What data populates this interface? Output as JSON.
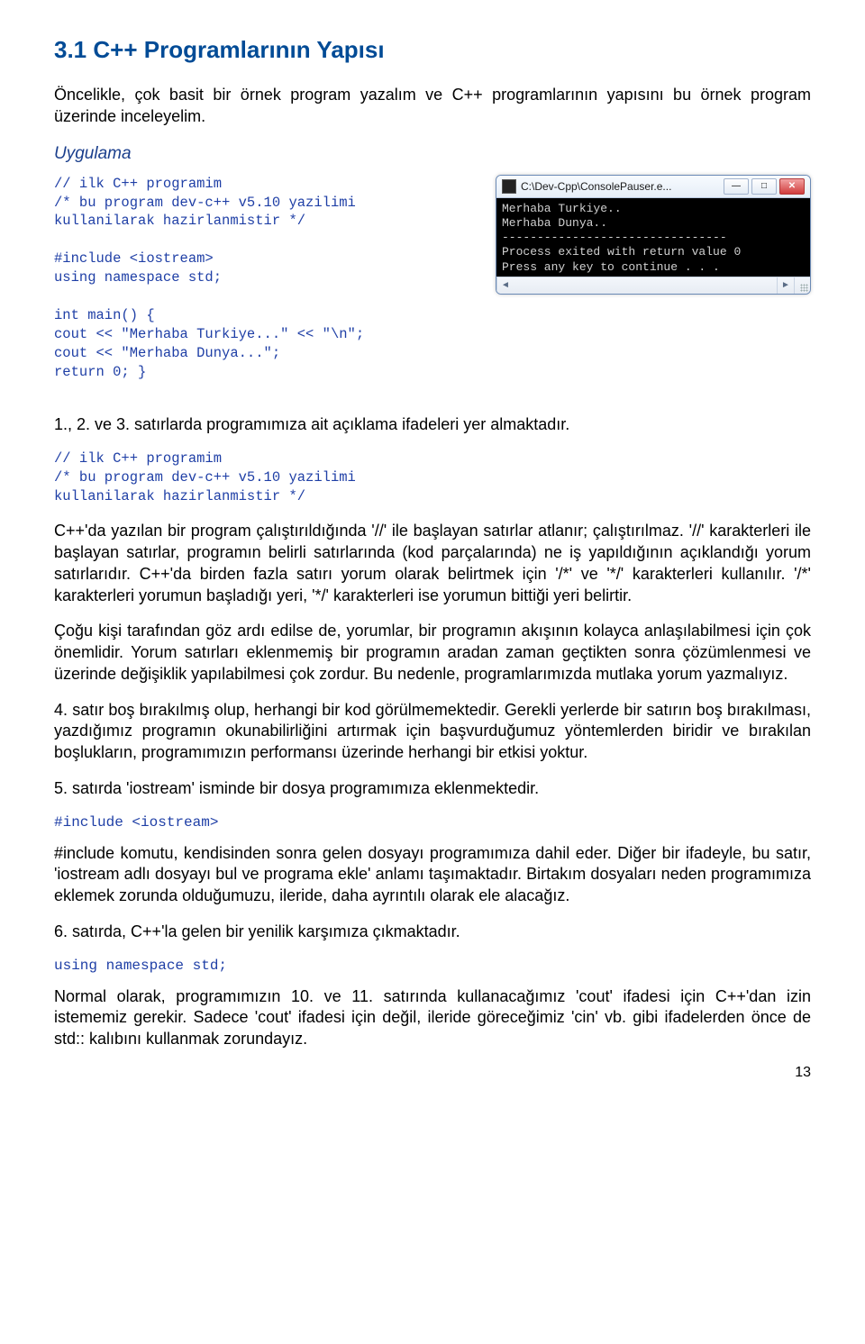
{
  "section_title": "3.1 C++ Programlarının Yapısı",
  "intro": "Öncelikle, çok basit bir örnek program yazalım ve C++ programlarının yapısını bu örnek program üzerinde inceleyelim.",
  "app_label": "Uygulama",
  "code1": "// ilk C++ programim\n/* bu program dev-c++ v5.10 yazilimi\nkullanilarak hazirlanmistir */\n\n#include <iostream>\nusing namespace std;\n\nint main() {\ncout << \"Merhaba Turkiye...\" << \"\\n\";\ncout << \"Merhaba Dunya...\";\nreturn 0; }",
  "console": {
    "title": "C:\\Dev-Cpp\\ConsolePauser.e...",
    "body": "Merhaba Turkiye..\nMerhaba Dunya..\n--------------------------------\nProcess exited with return value 0\nPress any key to continue . . .",
    "btn_min": "—",
    "btn_max": "□",
    "btn_close": "✕"
  },
  "p1": "1., 2. ve 3. satırlarda programımıza ait açıklama ifadeleri yer almaktadır.",
  "code2": "// ilk C++ programim\n/* bu program dev-c++ v5.10 yazilimi\nkullanilarak hazirlanmistir */",
  "p2": "C++'da yazılan bir program çalıştırıldığında '//' ile başlayan satırlar atlanır; çalıştırılmaz. '//' karakterleri ile başlayan satırlar, programın belirli satırlarında (kod parçalarında) ne iş yapıldığının açıklandığı yorum satırlarıdır. C++'da birden fazla satırı yorum olarak belirtmek için '/*' ve '*/' karakterleri kullanılır. '/*' karakterleri yorumun başladığı yeri, '*/' karakterleri ise yorumun bittiği yeri belirtir.",
  "p3": "Çoğu kişi tarafından göz ardı edilse de, yorumlar, bir programın akışının kolayca anlaşılabilmesi için çok önemlidir. Yorum satırları eklenmemiş bir programın aradan zaman geçtikten sonra çözümlenmesi ve üzerinde değişiklik yapılabilmesi çok zordur. Bu nedenle, programlarımızda mutlaka yorum yazmalıyız.",
  "p4": "4. satır boş bırakılmış olup, herhangi bir kod görülmemektedir. Gerekli yerlerde bir satırın boş bırakılması, yazdığımız programın okunabilirliğini artırmak için başvurduğumuz yöntemlerden biridir ve bırakılan boşlukların, programımızın performansı üzerinde herhangi bir etkisi yoktur.",
  "p5": "5. satırda 'iostream' isminde bir dosya programımıza eklenmektedir.",
  "code3": "#include <iostream>",
  "p6": "#include komutu, kendisinden sonra gelen dosyayı programımıza dahil eder. Diğer bir ifadeyle, bu satır, 'iostream adlı dosyayı bul ve programa ekle' anlamı taşımaktadır. Birtakım dosyaları neden programımıza eklemek zorunda olduğumuzu, ileride, daha ayrıntılı olarak ele alacağız.",
  "p7": "6. satırda, C++'la gelen bir yenilik karşımıza çıkmaktadır.",
  "code4": "using namespace std;",
  "p8": "Normal olarak, programımızın 10. ve 11. satırında kullanacağımız 'cout' ifadesi için C++'dan izin istememiz gerekir. Sadece 'cout' ifadesi için değil, ileride göreceğimiz 'cin' vb. gibi ifadelerden önce de std:: kalıbını kullanmak zorundayız.",
  "page_number": "13"
}
